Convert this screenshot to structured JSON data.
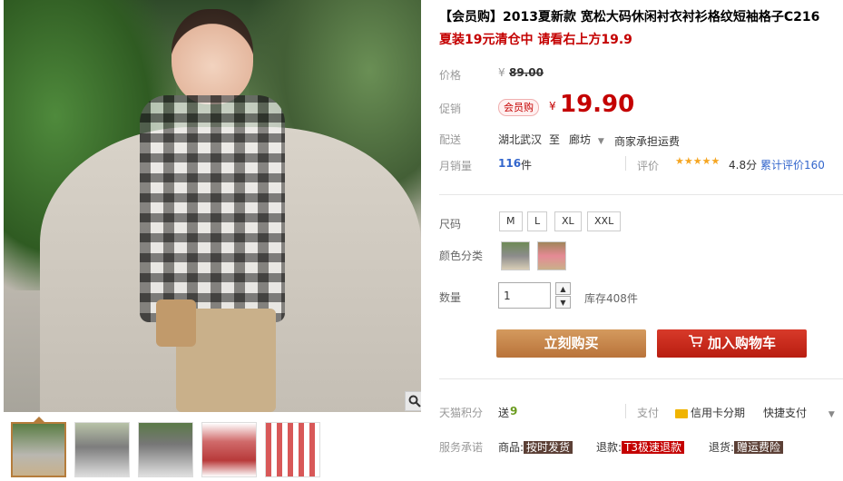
{
  "gallery": {
    "zoom_icon": "magnifier-icon",
    "thumb_count": 5
  },
  "product": {
    "title": "【会员购】2013夏新款 宽松大码休闲衬衣衬衫格纹短袖格子C216",
    "subtitle": "夏装19元清仓中 请看右上方19.9"
  },
  "price_row": {
    "label": "价格",
    "currency": "¥",
    "value": "89.00"
  },
  "promo_row": {
    "label": "促销",
    "badge": "会员购",
    "currency": "¥",
    "value": "19.90"
  },
  "shipping": {
    "label": "配送",
    "from": "湖北武汉",
    "to_word": "至",
    "to": "廊坊",
    "fee": "商家承担运费"
  },
  "sales": {
    "label": "月销量",
    "count": "116",
    "unit": "件",
    "rating_label": "评价",
    "stars": "★★★★★",
    "score": "4.8分",
    "reviews": "累计评价160"
  },
  "size": {
    "label": "尺码",
    "options": [
      "M",
      "L",
      "XL",
      "XXL"
    ]
  },
  "color": {
    "label": "颜色分类"
  },
  "quantity": {
    "label": "数量",
    "value": "1",
    "stock": "库存408件"
  },
  "actions": {
    "buy": "立刻购买",
    "cart": "加入购物车"
  },
  "points": {
    "label": "天猫积分",
    "give": "送",
    "amount": "9",
    "pay_label": "支付",
    "card": "信用卡分期",
    "fast_pay": "快捷支付"
  },
  "service": {
    "label": "服务承诺",
    "goods": "商品:",
    "goods_tag": "按时发货",
    "refund": "退款:",
    "refund_tag": "T3极速退款",
    "return": "退货:",
    "return_tag": "赠运费险"
  },
  "colors": {
    "price_red": "#c40000",
    "buy_button": "#c98748",
    "cart_button": "#c8281a"
  }
}
